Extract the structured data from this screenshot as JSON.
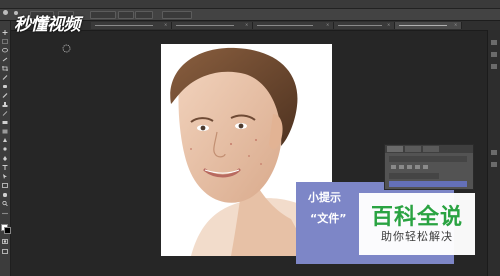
{
  "logo": {
    "text": "秒懂视频"
  },
  "document_tabs": [
    {
      "label": "",
      "active": false
    },
    {
      "label": "",
      "active": false
    },
    {
      "label": "",
      "active": false
    },
    {
      "label": "",
      "active": false
    },
    {
      "label": "",
      "active": true
    }
  ],
  "tip": {
    "title": "小提示",
    "body": "“文件”"
  },
  "watermark": {
    "title": "百科全说",
    "subtitle": "助你轻松解决"
  },
  "colors": {
    "foreground": "#ffffff",
    "background": "#000000",
    "tip_panel": "#7d86c7",
    "watermark_green": "#2aa342"
  }
}
